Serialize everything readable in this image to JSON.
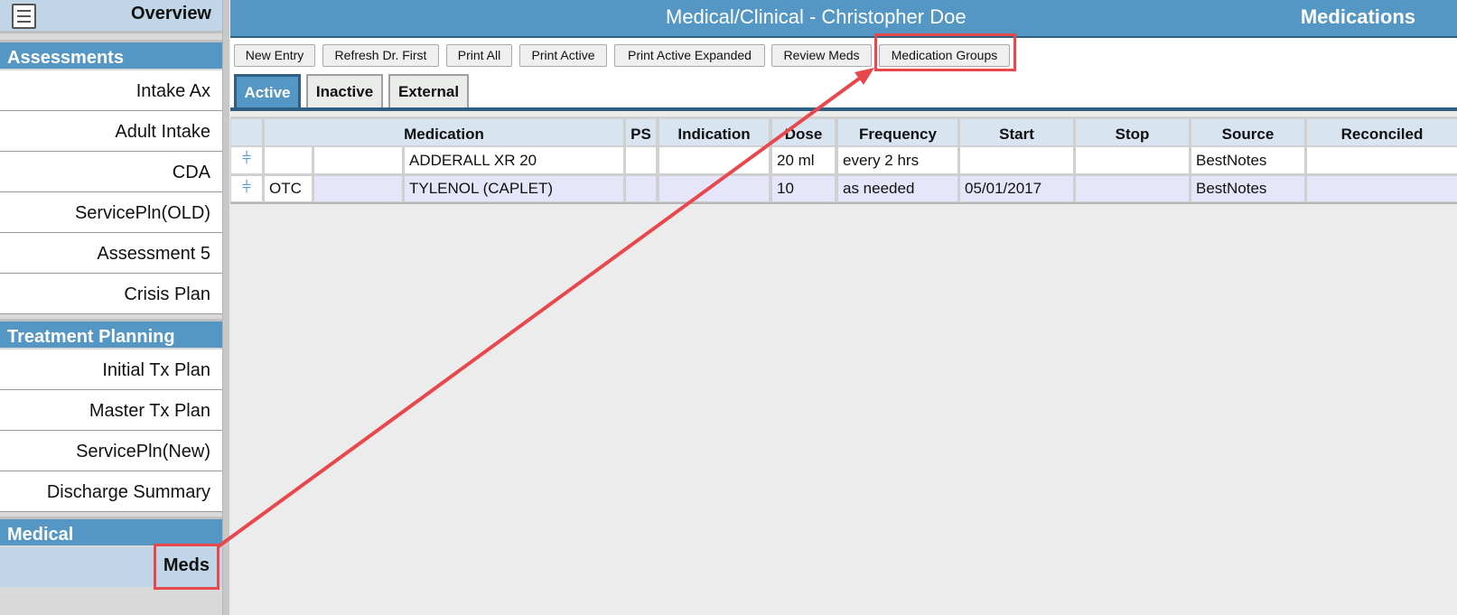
{
  "sidebar": {
    "overview_label": "Overview",
    "sections": [
      {
        "title": "Assessments",
        "items": [
          "Intake Ax",
          "Adult Intake",
          "CDA",
          "ServicePln(OLD)",
          "Assessment 5",
          "Crisis Plan"
        ]
      },
      {
        "title": "Treatment Planning",
        "items": [
          "Initial Tx Plan",
          "Master Tx Plan",
          "ServicePln(New)",
          "Discharge Summary"
        ]
      },
      {
        "title": "Medical",
        "items": [
          "Meds"
        ]
      }
    ]
  },
  "header": {
    "title": "Medical/Clinical - Christopher Doe",
    "section": "Medications"
  },
  "toolbar": {
    "buttons": [
      "New Entry",
      "Refresh Dr. First",
      "Print All",
      "Print Active",
      "Print Active Expanded",
      "Review Meds",
      "Medication Groups"
    ]
  },
  "tabs": [
    "Active",
    "Inactive",
    "External"
  ],
  "table": {
    "columns": [
      "",
      "Medication",
      "PS",
      "Indication",
      "Dose",
      "Frequency",
      "Start",
      "Stop",
      "Source",
      "Reconciled"
    ],
    "rows": [
      {
        "type": "",
        "sub": "",
        "medication": "ADDERALL XR 20",
        "ps": "",
        "indication": "",
        "dose": "20 ml",
        "frequency": "every 2 hrs",
        "start": "",
        "stop": "",
        "source": "BestNotes",
        "reconciled": ""
      },
      {
        "type": "OTC",
        "sub": "",
        "medication": "TYLENOL (CAPLET)",
        "ps": "",
        "indication": "",
        "dose": "10",
        "frequency": "as needed",
        "start": "05/01/2017",
        "stop": "",
        "source": "BestNotes",
        "reconciled": ""
      }
    ]
  },
  "colors": {
    "header_blue": "#5497c5",
    "highlight_red": "#e8484c",
    "chevron_blue": "#3f8ed6"
  }
}
